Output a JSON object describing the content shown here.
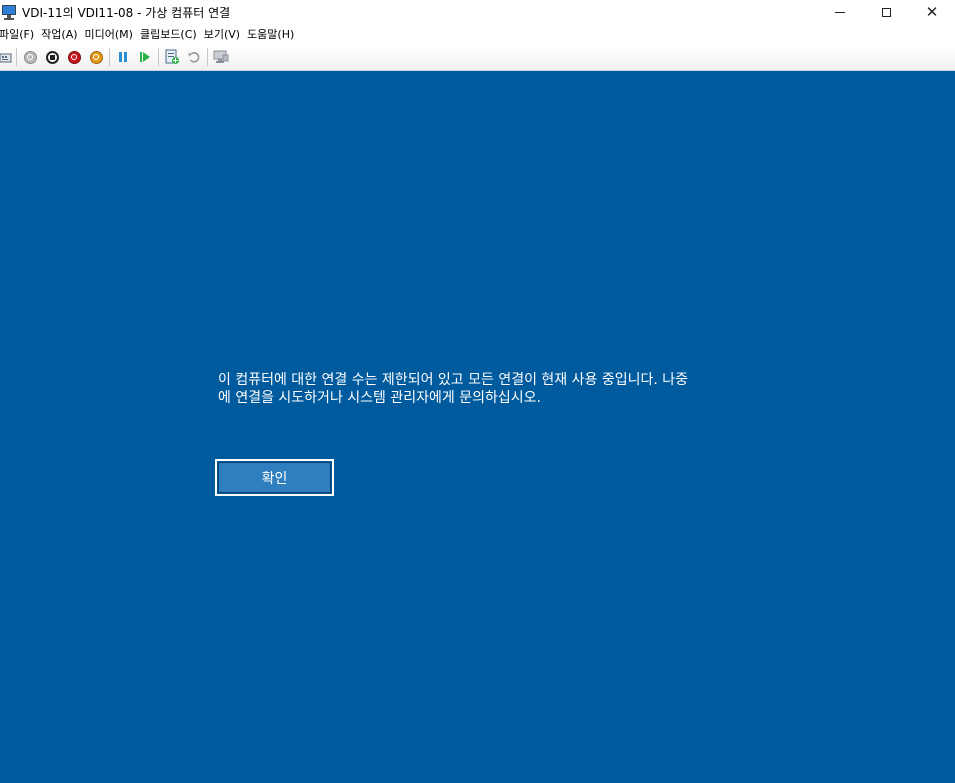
{
  "window": {
    "title": "VDI-11의 VDI11-08 - 가상 컴퓨터 연결",
    "minimize": "minimize",
    "maximize": "maximize",
    "close": "✕"
  },
  "menu": {
    "items": [
      {
        "label": "파일(F)"
      },
      {
        "label": "작업(A)"
      },
      {
        "label": "미디어(M)"
      },
      {
        "label": "클립보드(C)"
      },
      {
        "label": "보기(V)"
      },
      {
        "label": "도움말(H)"
      }
    ]
  },
  "toolbar": {
    "icons": [
      "ctrl-alt-del-icon",
      "start-icon",
      "turn-off-icon",
      "shutdown-icon",
      "save-icon",
      "pause-icon",
      "resume-icon",
      "checkpoint-icon",
      "revert-icon",
      "enhanced-session-icon"
    ]
  },
  "vm": {
    "background": "#005a9e",
    "message_line1": "이 컴퓨터에 대한 연결 수는 제한되어 있고 모든 연결이 현재 사용 중입니다. 나중",
    "message_line2": "에 연결을 시도하거나 시스템 관리자에게 문의하십시오.",
    "ok_label": "확인"
  }
}
